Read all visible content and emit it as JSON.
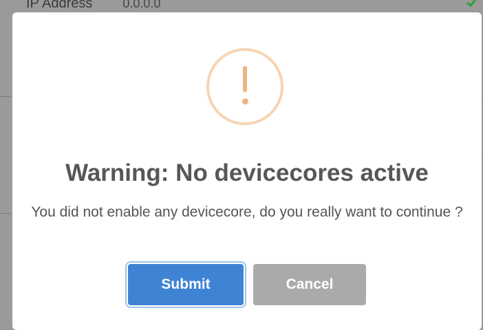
{
  "background": {
    "row_label": "IP Address",
    "row_value": "0.0.0.0",
    "check_icon": "check-icon"
  },
  "dialog": {
    "icon": "warning-icon",
    "title": "Warning: No devicecores active",
    "message": "You did not enable any devicecore, do you really want to continue ?",
    "buttons": {
      "submit": "Submit",
      "cancel": "Cancel"
    }
  },
  "colors": {
    "submit": "#3f84d4",
    "cancel": "#aaaaaa",
    "warning_ring": "#f7d4b2",
    "warning_mark": "#f0b37e",
    "check": "#2e9e3a"
  }
}
